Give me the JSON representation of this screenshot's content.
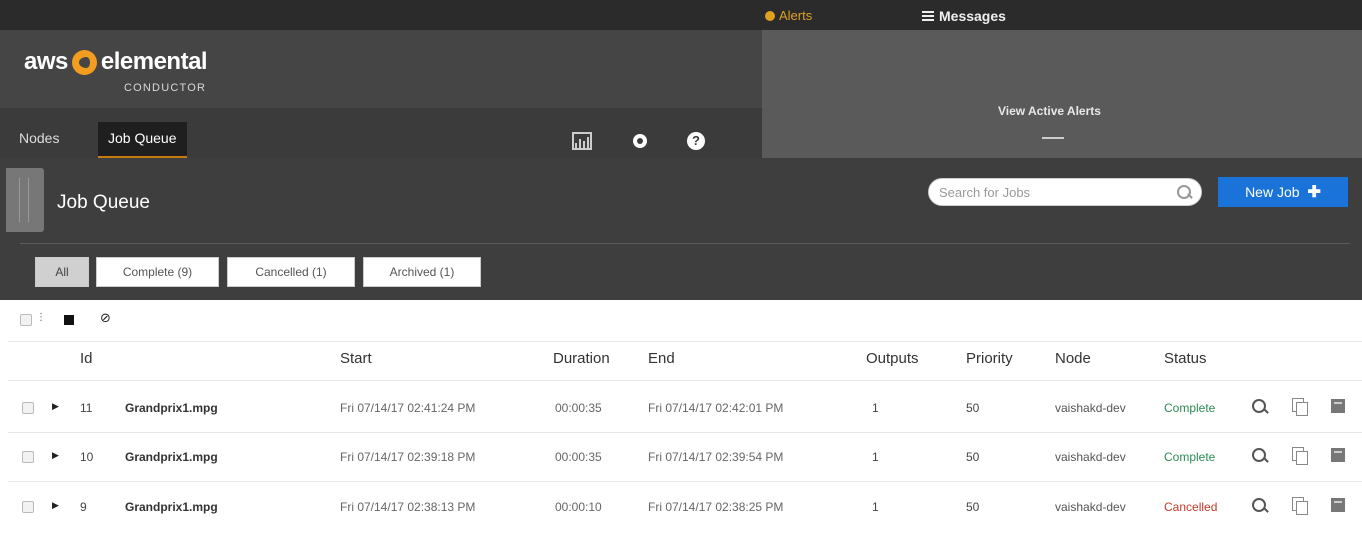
{
  "topbar": {
    "alerts_label": "Alerts",
    "messages_label": "Messages"
  },
  "brand": {
    "logo_left": "aws",
    "logo_right": "elemental",
    "product": "CONDUCTOR"
  },
  "alerts_panel": {
    "view_active_alerts": "View Active Alerts"
  },
  "nav": {
    "nodes": "Nodes",
    "job_queue": "Job Queue"
  },
  "page": {
    "title": "Job Queue",
    "search_placeholder": "Search for Jobs",
    "new_job": "New Job"
  },
  "filters": {
    "all": "All",
    "complete": "Complete (9)",
    "cancelled": "Cancelled (1)",
    "archived": "Archived (1)"
  },
  "table": {
    "columns": {
      "id": "Id",
      "start": "Start",
      "duration": "Duration",
      "end": "End",
      "outputs": "Outputs",
      "priority": "Priority",
      "node": "Node",
      "status": "Status"
    },
    "rows": [
      {
        "id": "11",
        "name": "Grandprix1.mpg",
        "start": "Fri 07/14/17 02:41:24 PM",
        "duration": "00:00:35",
        "end": "Fri 07/14/17 02:42:01 PM",
        "outputs": "1",
        "priority": "50",
        "node": "vaishakd-dev",
        "status": "Complete"
      },
      {
        "id": "10",
        "name": "Grandprix1.mpg",
        "start": "Fri 07/14/17 02:39:18 PM",
        "duration": "00:00:35",
        "end": "Fri 07/14/17 02:39:54 PM",
        "outputs": "1",
        "priority": "50",
        "node": "vaishakd-dev",
        "status": "Complete"
      },
      {
        "id": "9",
        "name": "Grandprix1.mpg",
        "start": "Fri 07/14/17 02:38:13 PM",
        "duration": "00:00:10",
        "end": "Fri 07/14/17 02:38:25 PM",
        "outputs": "1",
        "priority": "50",
        "node": "vaishakd-dev",
        "status": "Cancelled"
      }
    ]
  }
}
